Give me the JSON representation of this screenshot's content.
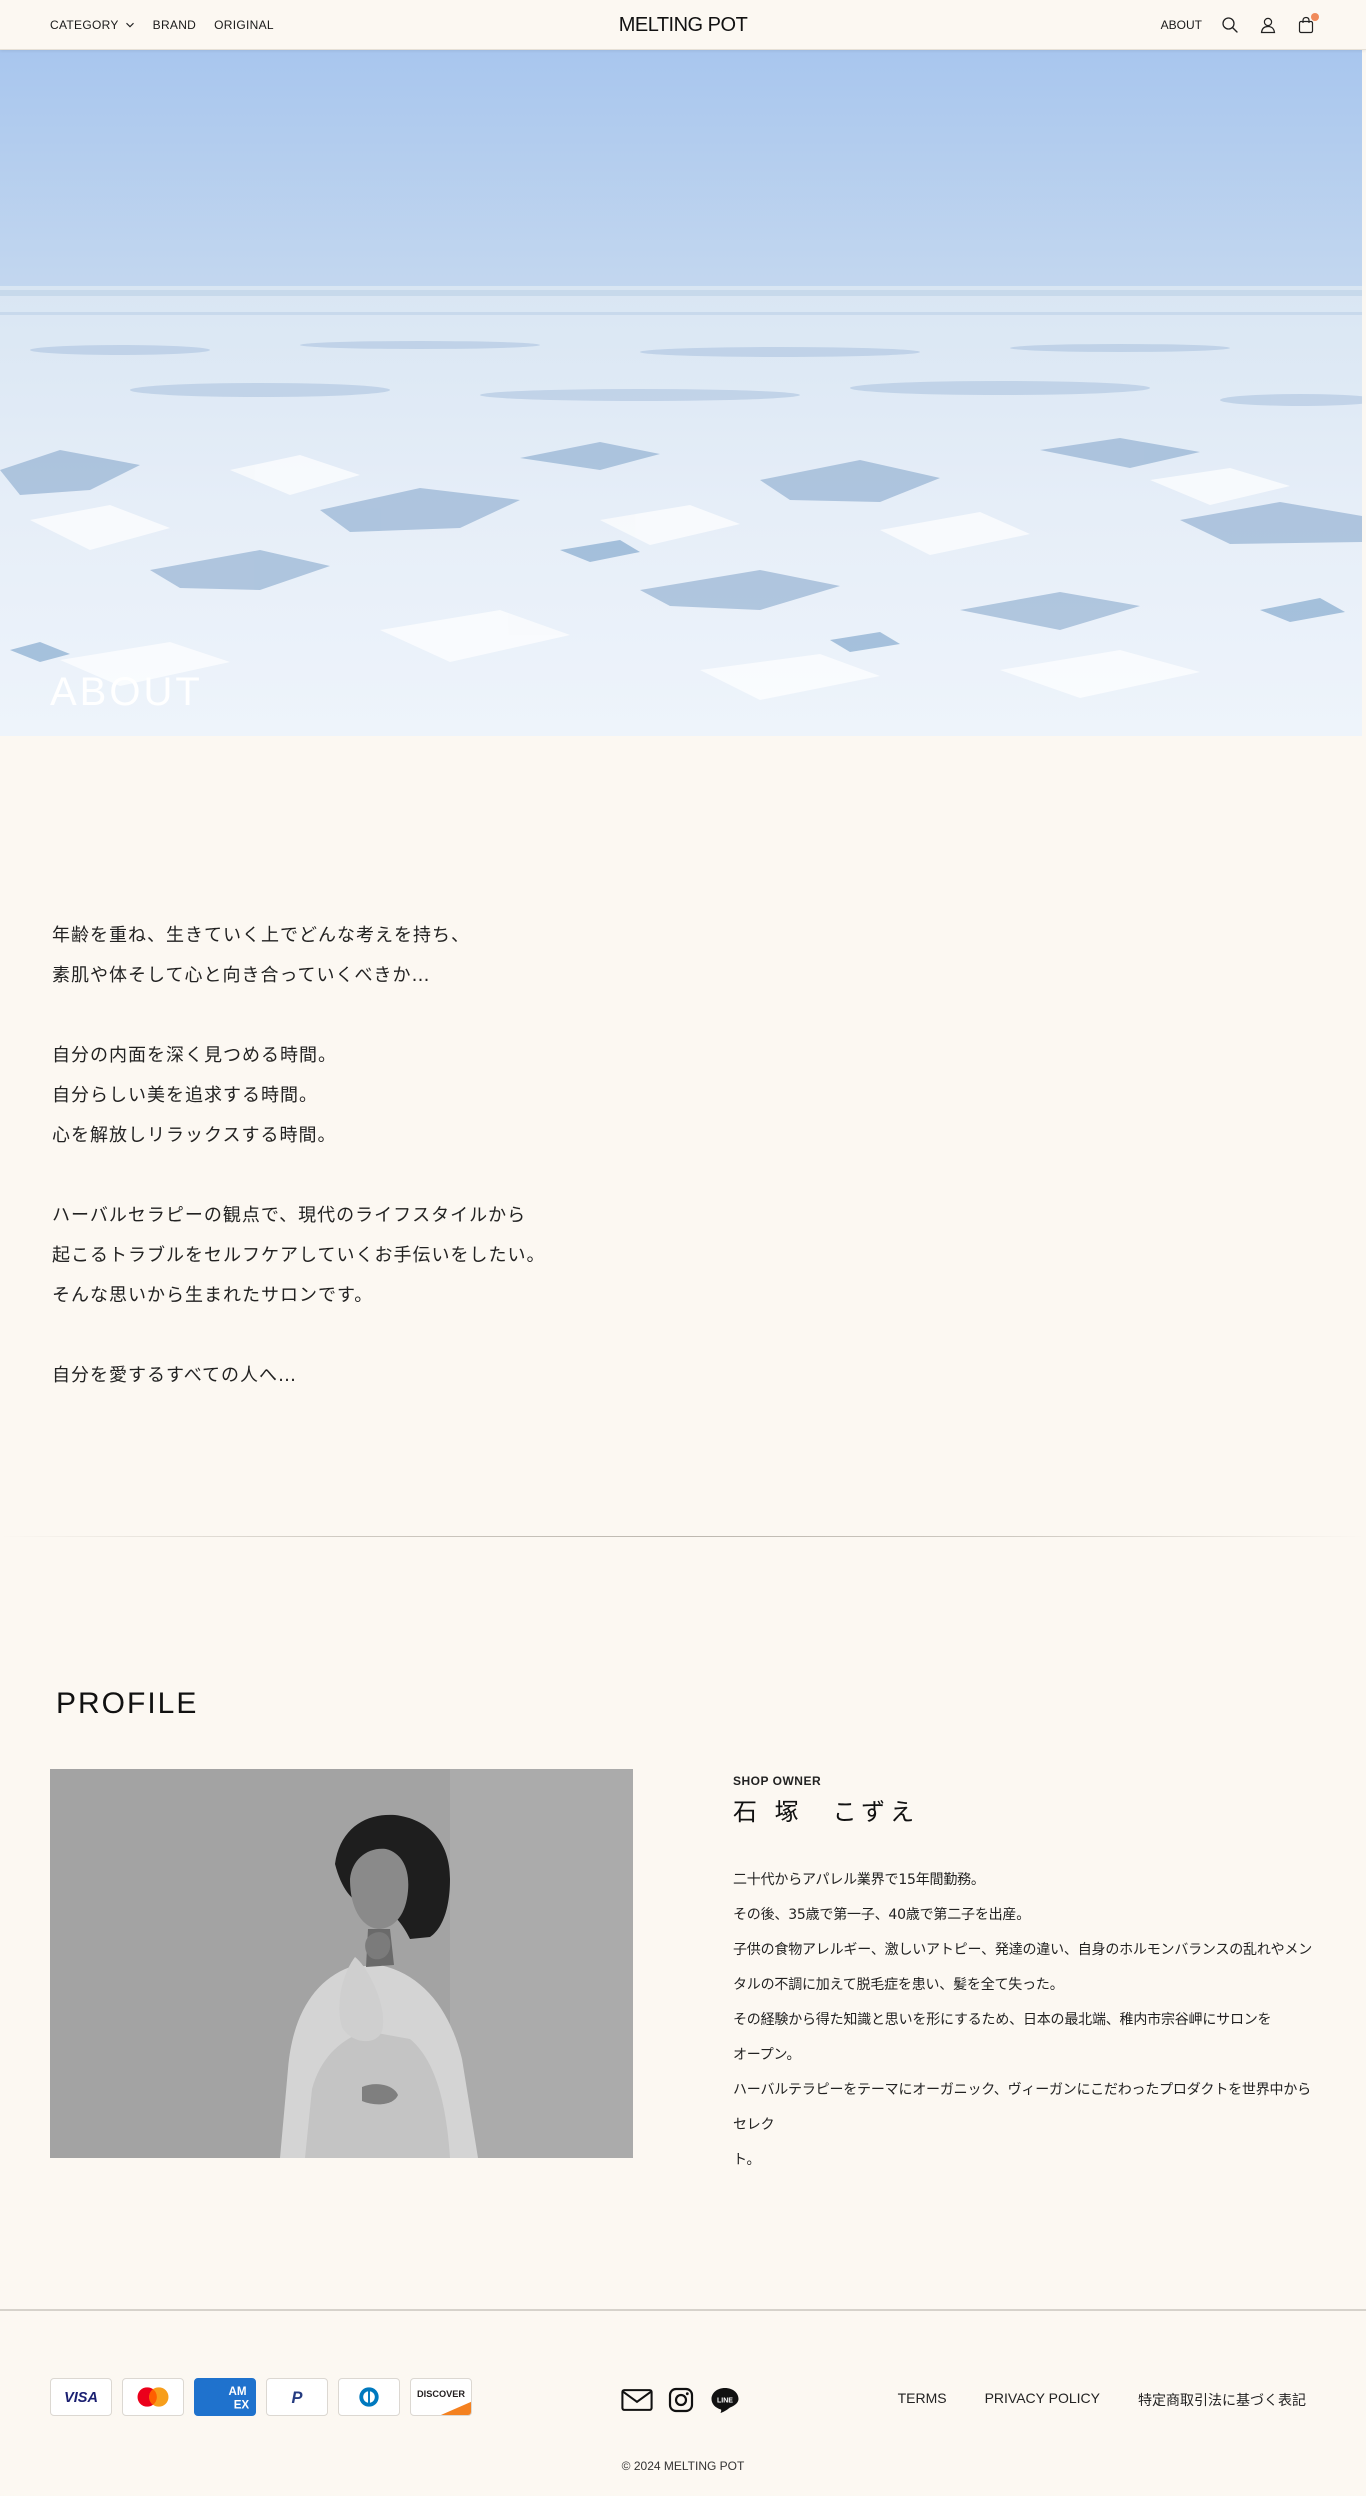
{
  "header": {
    "nav_left": [
      "CATEGORY",
      "BRAND",
      "ORIGINAL"
    ],
    "logo": "MELTING POT",
    "nav_right_about": "ABOUT",
    "icons": [
      "search-icon",
      "account-icon",
      "cart-icon"
    ]
  },
  "hero": {
    "title": "ABOUT"
  },
  "intro": {
    "lines": [
      "年齢を重ね、生きていく上でどんな考えを持ち、",
      "素肌や体そして心と向き合っていくべきか…",
      "",
      "自分の内面を深く見つめる時間。",
      "自分らしい美を追求する時間。",
      "心を解放しリラックスする時間。",
      "",
      "ハーバルセラピーの観点で、現代のライフスタイルから",
      "起こるトラブルをセルフケアしていくお手伝いをしたい。",
      "そんな思いから生まれたサロンです。",
      "",
      "自分を愛するすべての人へ…"
    ]
  },
  "profile": {
    "heading": "PROFILE",
    "owner_label": "SHOP OWNER",
    "owner_name": "石 塚　こずえ",
    "bio_lines": [
      "二十代からアパレル業界で15年間勤務。",
      "その後、35歳で第一子、40歳で第二子を出産。",
      "子供の食物アレルギー、激しいアトピー、発達の違い、自身のホルモンバランスの乱れやメン",
      "タルの不調に加えて脱毛症を患い、髪を全て失った。",
      "その経験から得た知識と思いを形にするため、日本の最北端、稚内市宗谷岬にサロンを",
      "オープン。",
      "ハーバルテラピーをテーマにオーガニック、ヴィーガンにこだわったプロダクトを世界中からセレク",
      "ト。"
    ]
  },
  "footer": {
    "payments": {
      "visa": "VISA",
      "mastercard": "mastercard",
      "amex_top": "AM",
      "amex_bottom": "EX",
      "paypal": "P",
      "diners": "diners",
      "discover": "DISCOVER"
    },
    "socials": [
      "mail-icon",
      "instagram-icon",
      "line-icon"
    ],
    "line_text": "LINE",
    "links": [
      "TERMS",
      "PRIVACY POLICY",
      "特定商取引法に基づく表記"
    ],
    "copyright": "© 2024 MELTING POT"
  },
  "colors": {
    "background": "#fcf8f2",
    "cart_badge": "#f08a5a",
    "amex_blue": "#1f72cd",
    "discover_orange": "#f48120"
  }
}
